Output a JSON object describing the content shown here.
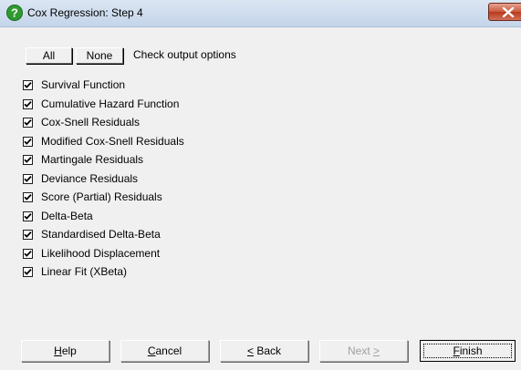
{
  "window": {
    "title": "Cox Regression: Step 4",
    "close_symbol": "✕"
  },
  "top_buttons": {
    "all_label": "All",
    "none_label": "None",
    "check_output_label": "Check output options"
  },
  "options": [
    {
      "label": "Survival Function",
      "checked": true
    },
    {
      "label": "Cumulative Hazard Function",
      "checked": true
    },
    {
      "label": "Cox-Snell Residuals",
      "checked": true
    },
    {
      "label": "Modified Cox-Snell Residuals",
      "checked": true
    },
    {
      "label": "Martingale Residuals",
      "checked": true
    },
    {
      "label": "Deviance Residuals",
      "checked": true
    },
    {
      "label": "Score (Partial) Residuals",
      "checked": true
    },
    {
      "label": "Delta-Beta",
      "checked": true
    },
    {
      "label": "Standardised Delta-Beta",
      "checked": true
    },
    {
      "label": "Likelihood Displacement",
      "checked": true
    },
    {
      "label": "Linear Fit (XBeta)",
      "checked": true
    }
  ],
  "footer_buttons": {
    "help": {
      "mnemonic": "H",
      "rest": "elp"
    },
    "cancel": {
      "mnemonic": "C",
      "rest": "ancel"
    },
    "back": {
      "mnemonic": "<",
      "rest": " Back"
    },
    "next": {
      "pre": "Next ",
      "mnemonic": ">"
    },
    "finish": {
      "mnemonic": "F",
      "rest": "inish"
    }
  },
  "icons": {
    "title_icon": "help-question-icon",
    "close_icon": "close-icon",
    "check_icon": "checkmark-icon"
  },
  "colors": {
    "title_icon_green": "#2f9a2f",
    "close_red": "#c0432a",
    "dialog_background": "#f0f0f0",
    "disabled_text": "#a0a0a0"
  }
}
